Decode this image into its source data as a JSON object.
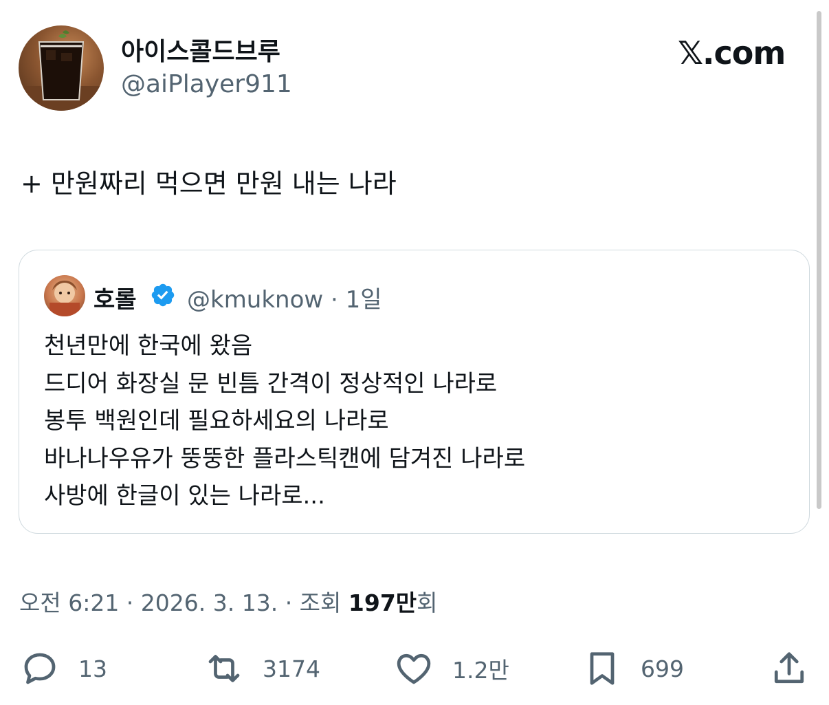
{
  "author": {
    "name": "아이스콜드브루",
    "handle": "@aiPlayer911"
  },
  "brand": "𝕏.com",
  "tweet": {
    "text": "+ 만원짜리 먹으면 만원 내는 나라"
  },
  "quoted": {
    "name": "호롤",
    "handle_time": "@kmuknow · 1일",
    "lines": [
      "천년만에 한국에 왔음",
      "드디어 화장실 문 빈틈 간격이 정상적인 나라로",
      "봉투 백원인데 필요하세요의 나라로",
      "바나나우유가 뚱뚱한 플라스틱캔에 담겨진 나라로",
      "사방에 한글이 있는 나라로..."
    ]
  },
  "meta": {
    "time_date": "오전 6:21 · 2026. 3. 13. · 조회 ",
    "views_num": "197",
    "views_unit": "만",
    "views_label": "회"
  },
  "actions": {
    "replies": "13",
    "retweets": "3174",
    "likes": "1.2만",
    "bookmarks": "699"
  },
  "icons": [
    "reply-icon",
    "retweet-icon",
    "like-icon",
    "bookmark-icon",
    "share-icon",
    "verified-badge-icon"
  ],
  "colors": {
    "text": "#0f1419",
    "secondary": "#536471",
    "border": "#cfd9de",
    "verified": "#1d9bf0"
  }
}
